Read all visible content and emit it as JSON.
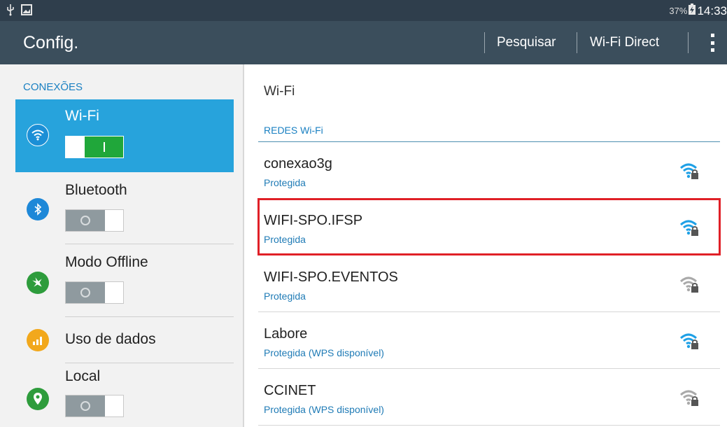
{
  "status_bar": {
    "battery_percent": "37%",
    "time": "14:33",
    "icons": [
      "usb-icon",
      "image-icon",
      "battery-icon"
    ]
  },
  "action_bar": {
    "title": "Config.",
    "actions": {
      "search": "Pesquisar",
      "wifi_direct": "Wi-Fi Direct"
    },
    "overflow_icon": "more-vertical-icon"
  },
  "sidebar": {
    "category": "CONEXÕES",
    "items": [
      {
        "label": "Wi-Fi",
        "icon": "wifi-icon",
        "icon_color": "#1b8fd6",
        "toggle": "on",
        "selected": true
      },
      {
        "label": "Bluetooth",
        "icon": "bluetooth-icon",
        "icon_color": "#1e88d8",
        "toggle": "off"
      },
      {
        "label": "Modo Offline",
        "icon": "airplane-icon",
        "icon_color": "#2e9c3c",
        "toggle": "off"
      },
      {
        "label": "Uso de dados",
        "icon": "data-usage-icon",
        "icon_color": "#f2a81c"
      },
      {
        "label": "Local",
        "icon": "location-icon",
        "icon_color": "#2e9c3c",
        "toggle": "off"
      }
    ]
  },
  "main": {
    "title": "Wi-Fi",
    "subheader": "REDES Wi-Fi",
    "networks": [
      {
        "name": "conexao3g",
        "security": "Protegida",
        "signal_color": "#1ea0e6"
      },
      {
        "name": "WIFI-SPO.IFSP",
        "security": "Protegida",
        "signal_color": "#1ea0e6",
        "highlighted": true
      },
      {
        "name": "WIFI-SPO.EVENTOS",
        "security": "Protegida",
        "signal_color": "#a9a9a9"
      },
      {
        "name": "Labore",
        "security": "Protegida (WPS disponível)",
        "signal_color": "#1ea0e6"
      },
      {
        "name": "CCINET",
        "security": "Protegida (WPS disponível)",
        "signal_color": "#a9a9a9"
      }
    ]
  },
  "colors": {
    "accent": "#27a3dc",
    "switch_on": "#20a73a",
    "highlight_border": "#e02027",
    "action_bar": "#3b4e5c"
  }
}
